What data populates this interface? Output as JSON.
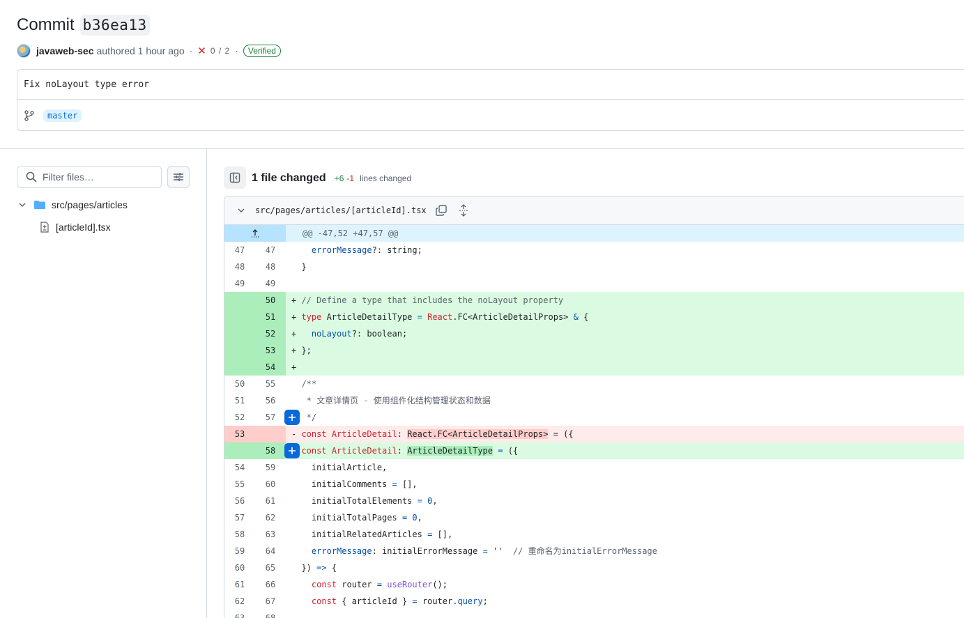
{
  "header": {
    "title_word": "Commit",
    "sha": "b36ea13",
    "author": "javaweb-sec",
    "authored_label": "authored 1 hour ago",
    "checks": "0 / 2",
    "verified_label": "Verified"
  },
  "message": {
    "text": "Fix noLayout type error",
    "branch": "master"
  },
  "sidebar": {
    "filter_placeholder": "Filter files…",
    "folder": "src/pages/articles",
    "file": "[articleId].tsx"
  },
  "diff_summary": {
    "files_changed": "1 file changed",
    "additions": "+6",
    "deletions": "-1",
    "lines_label": "lines changed"
  },
  "file": {
    "path": "src/pages/articles/[articleId].tsx",
    "hunk": "@@ -47,52 +47,57 @@"
  },
  "lines": [
    {
      "old": "47",
      "new": "47",
      "text": "  errorMessage?: string;"
    },
    {
      "old": "48",
      "new": "48",
      "text": "}"
    },
    {
      "old": "49",
      "new": "49",
      "text": ""
    },
    {
      "old": "",
      "new": "50",
      "text": "+ // Define a type that includes the noLayout property"
    },
    {
      "old": "",
      "new": "51",
      "text": "+ type ArticleDetailType = React.FC<ArticleDetailProps> & {"
    },
    {
      "old": "",
      "new": "52",
      "text": "+   noLayout?: boolean;"
    },
    {
      "old": "",
      "new": "53",
      "text": "+ };"
    },
    {
      "old": "",
      "new": "54",
      "text": "+"
    },
    {
      "old": "50",
      "new": "55",
      "text": "/**"
    },
    {
      "old": "51",
      "new": "56",
      "text": " * 文章详情页 - 使用组件化结构管理状态和数据"
    },
    {
      "old": "52",
      "new": "57",
      "text": " */"
    },
    {
      "old": "53",
      "new": "",
      "text": "- const ArticleDetail: React.FC<ArticleDetailProps> = ({"
    },
    {
      "old": "",
      "new": "58",
      "text": "const ArticleDetail: ArticleDetailType = ({"
    },
    {
      "old": "54",
      "new": "59",
      "text": "  initialArticle,"
    },
    {
      "old": "55",
      "new": "60",
      "text": "  initialComments = [],"
    },
    {
      "old": "56",
      "new": "61",
      "text": "  initialTotalElements = 0,"
    },
    {
      "old": "57",
      "new": "62",
      "text": "  initialTotalPages = 0,"
    },
    {
      "old": "58",
      "new": "63",
      "text": "  initialRelatedArticles = [],"
    },
    {
      "old": "59",
      "new": "64",
      "text": "  errorMessage: initialErrorMessage = ''  // 重命名为initialErrorMessage"
    },
    {
      "old": "60",
      "new": "65",
      "text": "}) => {"
    },
    {
      "old": "61",
      "new": "66",
      "text": "  const router = useRouter();"
    },
    {
      "old": "62",
      "new": "67",
      "text": "  const { articleId } = router.query;"
    },
    {
      "old": "63",
      "new": "68",
      "text": ""
    }
  ]
}
